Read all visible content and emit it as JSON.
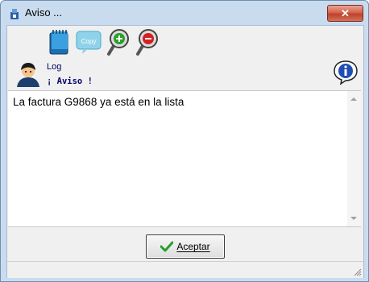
{
  "window": {
    "title": "Aviso ..."
  },
  "titlebar": {
    "close_glyph": "✕"
  },
  "toolbar": {
    "buttons": [
      {
        "icon": "notepad-icon"
      },
      {
        "icon": "copy-icon",
        "text": "Copy"
      },
      {
        "icon": "zoom-in-icon"
      },
      {
        "icon": "zoom-out-icon"
      }
    ]
  },
  "header": {
    "log_label": "Log",
    "aviso_label": "¡ Aviso !"
  },
  "message": {
    "text": "La factura G9868 ya está en la lista"
  },
  "footer": {
    "accept_label": "Aceptar"
  },
  "colors": {
    "accent": "#c9dcef",
    "close": "#c0412a",
    "text_blue": "#000066"
  }
}
